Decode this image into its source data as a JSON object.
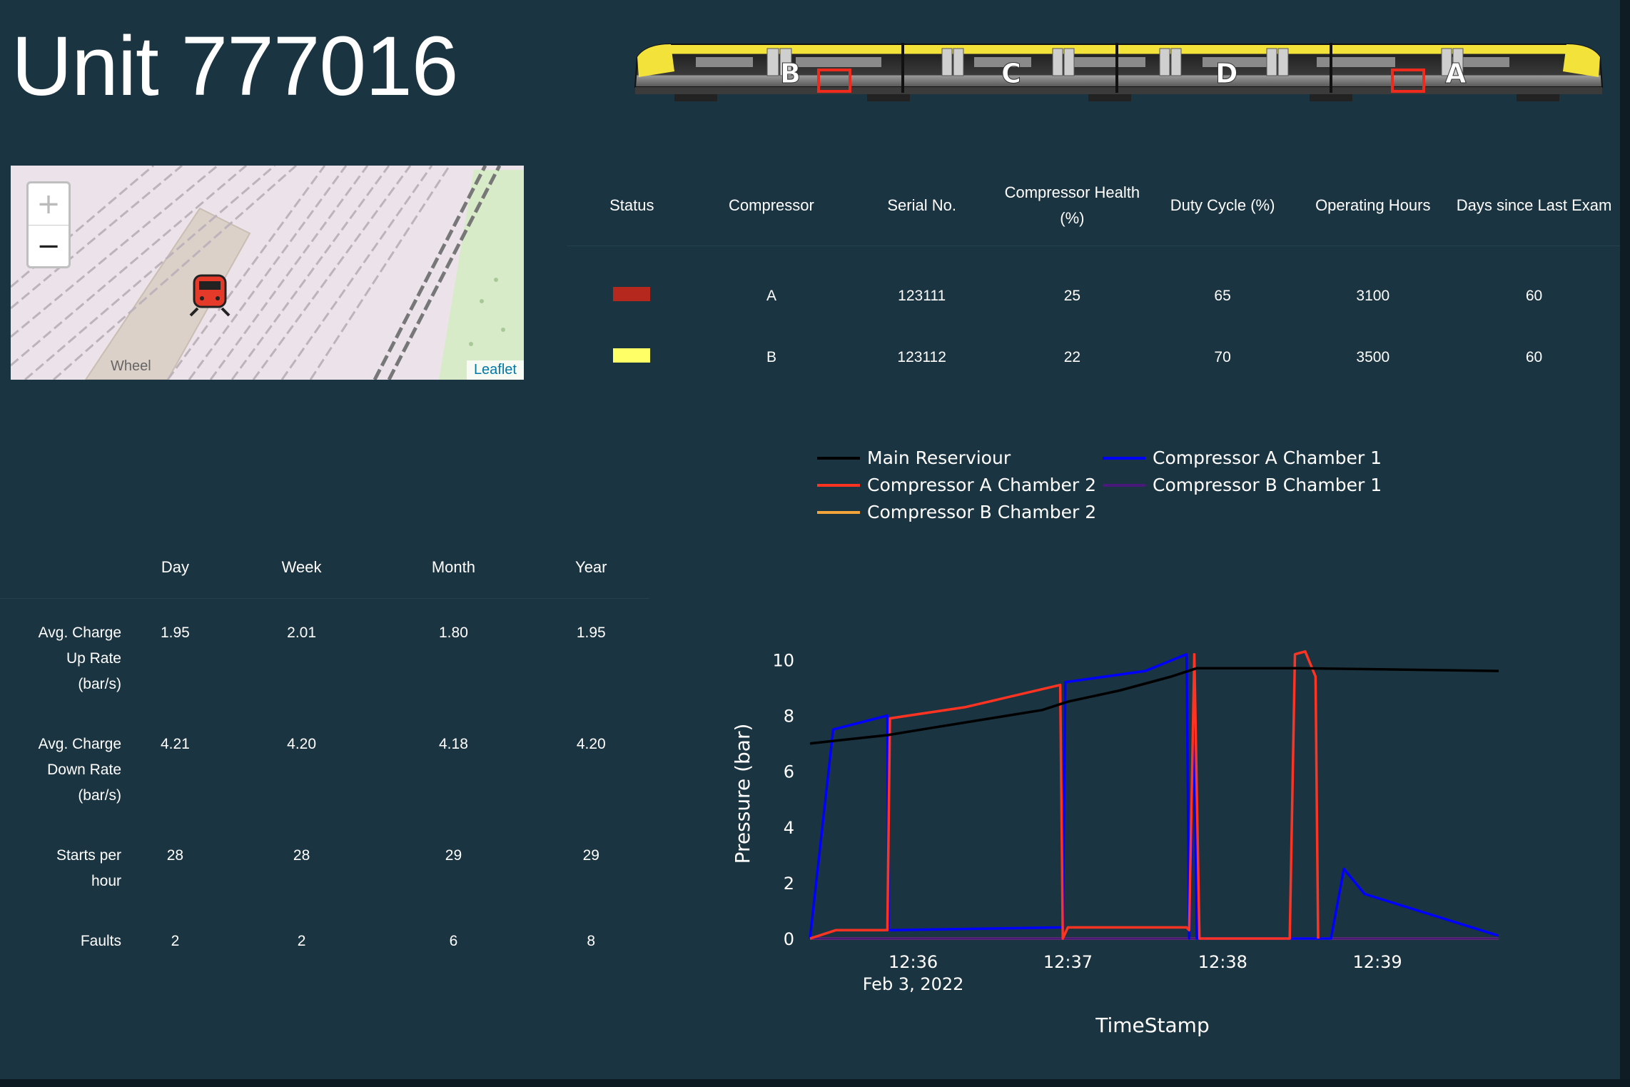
{
  "title": "Unit 777016",
  "train": {
    "car_labels": [
      "B",
      "C",
      "D",
      "A"
    ]
  },
  "map": {
    "zoom_in": "+",
    "zoom_out": "−",
    "attribution": "Leaflet",
    "street_label": "Wheel"
  },
  "compressor_table": {
    "headers": [
      "Status",
      "Compressor",
      "Serial No.",
      "Compressor Health (%)",
      "Duty Cycle (%)",
      "Operating Hours",
      "Days since Last Exam"
    ],
    "rows": [
      {
        "status_color": "#b5281d",
        "compressor": "A",
        "serial": "123111",
        "health": "25",
        "duty": "65",
        "hours": "3100",
        "days": "60"
      },
      {
        "status_color": "#ffff66",
        "compressor": "B",
        "serial": "123112",
        "health": "22",
        "duty": "70",
        "hours": "3500",
        "days": "60"
      }
    ]
  },
  "stats_table": {
    "headers": [
      "Day",
      "Week",
      "Month",
      "Year"
    ],
    "rows": [
      {
        "label": "Avg. Charge Up Rate (bar/s)",
        "values": [
          "1.95",
          "2.01",
          "1.80",
          "1.95"
        ]
      },
      {
        "label": "Avg. Charge Down Rate (bar/s)",
        "values": [
          "4.21",
          "4.20",
          "4.18",
          "4.20"
        ]
      },
      {
        "label": "Starts per hour",
        "values": [
          "28",
          "28",
          "29",
          "29"
        ]
      },
      {
        "label": "Faults",
        "values": [
          "2",
          "2",
          "6",
          "8"
        ]
      }
    ]
  },
  "chart_data": {
    "type": "line",
    "xlabel": "TimeStamp",
    "ylabel": "Pressure (bar)",
    "x_ticks": [
      "12:36",
      "12:37",
      "12:38",
      "12:39"
    ],
    "x_date_label": "Feb 3, 2022",
    "y_ticks": [
      0,
      2,
      4,
      6,
      8,
      10
    ],
    "ylim": [
      0,
      10.5
    ],
    "xlim": [
      "12:35:20",
      "12:39:47"
    ],
    "legend_placement": "top",
    "series": [
      {
        "name": "Main Reserviour",
        "color": "#000000",
        "points": [
          [
            "12:35:20",
            7.0
          ],
          [
            "12:35:30",
            7.1
          ],
          [
            "12:35:50",
            7.3
          ],
          [
            "12:36:10",
            7.6
          ],
          [
            "12:36:30",
            7.9
          ],
          [
            "12:36:50",
            8.2
          ],
          [
            "12:37:00",
            8.5
          ],
          [
            "12:37:20",
            8.9
          ],
          [
            "12:37:40",
            9.4
          ],
          [
            "12:37:50",
            9.7
          ],
          [
            "12:38:30",
            9.7
          ],
          [
            "12:39:47",
            9.6
          ]
        ]
      },
      {
        "name": "Compressor A Chamber 1",
        "color": "#0000ff",
        "points": [
          [
            "12:35:20",
            0
          ],
          [
            "12:35:29",
            7.5
          ],
          [
            "12:35:50",
            8.0
          ],
          [
            "12:35:50.5",
            0.3
          ],
          [
            "12:36:58",
            0.4
          ],
          [
            "12:36:59",
            9.2
          ],
          [
            "12:37:30",
            9.6
          ],
          [
            "12:37:46",
            10.2
          ],
          [
            "12:37:47",
            0
          ],
          [
            "12:37:49",
            8.1
          ],
          [
            "12:37:50",
            0
          ],
          [
            "12:38:42",
            0
          ],
          [
            "12:38:47",
            2.5
          ],
          [
            "12:38:55",
            1.6
          ],
          [
            "12:39:47",
            0.1
          ]
        ]
      },
      {
        "name": "Compressor A Chamber 2",
        "color": "#ff3322",
        "points": [
          [
            "12:35:20",
            0
          ],
          [
            "12:35:30",
            0.3
          ],
          [
            "12:35:50",
            0.3
          ],
          [
            "12:35:51",
            7.9
          ],
          [
            "12:36:20",
            8.3
          ],
          [
            "12:36:57",
            9.1
          ],
          [
            "12:36:58",
            0
          ],
          [
            "12:37:00",
            0.4
          ],
          [
            "12:37:46",
            0.4
          ],
          [
            "12:37:47",
            0.3
          ],
          [
            "12:37:49",
            10.2
          ],
          [
            "12:37:51",
            0
          ],
          [
            "12:38:26",
            0
          ],
          [
            "12:38:28",
            10.2
          ],
          [
            "12:38:32",
            10.3
          ],
          [
            "12:38:36",
            9.4
          ],
          [
            "12:38:37",
            0
          ]
        ]
      },
      {
        "name": "Compressor B Chamber 1",
        "color": "#4a1a7a",
        "points": [
          [
            "12:35:20",
            0
          ],
          [
            "12:39:47",
            0
          ]
        ]
      },
      {
        "name": "Compressor B Chamber 2",
        "color": "#f2a43a",
        "points": [
          [
            "12:35:20",
            0
          ],
          [
            "12:39:47",
            0
          ]
        ]
      }
    ]
  }
}
